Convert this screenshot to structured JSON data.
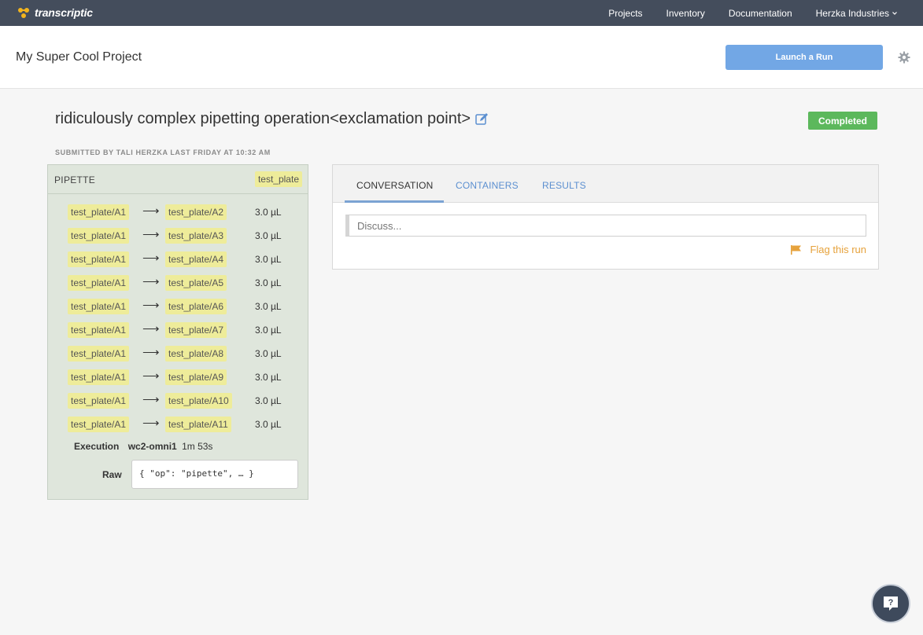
{
  "nav": {
    "logo_text": "transcriptic",
    "links": [
      "Projects",
      "Inventory",
      "Documentation"
    ],
    "org": "Herzka Industries"
  },
  "project": {
    "title": "My Super Cool Project",
    "launch_label": "Launch a Run"
  },
  "run": {
    "title": "ridiculously complex pipetting operation<exclamation point>",
    "status": "Completed",
    "submitted": "SUBMITTED BY TALI HERZKA LAST FRIDAY AT 10:32 AM"
  },
  "pipette": {
    "title": "PIPETTE",
    "container": "test_plate",
    "transfers": [
      {
        "from": "test_plate/A1",
        "to": "test_plate/A2",
        "volume": "3.0 µL"
      },
      {
        "from": "test_plate/A1",
        "to": "test_plate/A3",
        "volume": "3.0 µL"
      },
      {
        "from": "test_plate/A1",
        "to": "test_plate/A4",
        "volume": "3.0 µL"
      },
      {
        "from": "test_plate/A1",
        "to": "test_plate/A5",
        "volume": "3.0 µL"
      },
      {
        "from": "test_plate/A1",
        "to": "test_plate/A6",
        "volume": "3.0 µL"
      },
      {
        "from": "test_plate/A1",
        "to": "test_plate/A7",
        "volume": "3.0 µL"
      },
      {
        "from": "test_plate/A1",
        "to": "test_plate/A8",
        "volume": "3.0 µL"
      },
      {
        "from": "test_plate/A1",
        "to": "test_plate/A9",
        "volume": "3.0 µL"
      },
      {
        "from": "test_plate/A1",
        "to": "test_plate/A10",
        "volume": "3.0 µL"
      },
      {
        "from": "test_plate/A1",
        "to": "test_plate/A11",
        "volume": "3.0 µL"
      }
    ],
    "arrow": "⟶",
    "execution_label": "Execution",
    "machine": "wc2-omni1",
    "duration": "1m 53s",
    "raw_label": "Raw",
    "raw_value": "{ \"op\": \"pipette\", … }"
  },
  "tabs": {
    "conversation": "CONVERSATION",
    "containers": "CONTAINERS",
    "results": "RESULTS"
  },
  "conversation": {
    "placeholder": "Discuss...",
    "flag_label": "Flag this run"
  },
  "colors": {
    "nav_bg": "#444d5c",
    "accent_blue": "#72a7e5",
    "status_green": "#5cb85c",
    "chip_yellow": "#eeec9a",
    "flag_orange": "#e6a23c"
  }
}
